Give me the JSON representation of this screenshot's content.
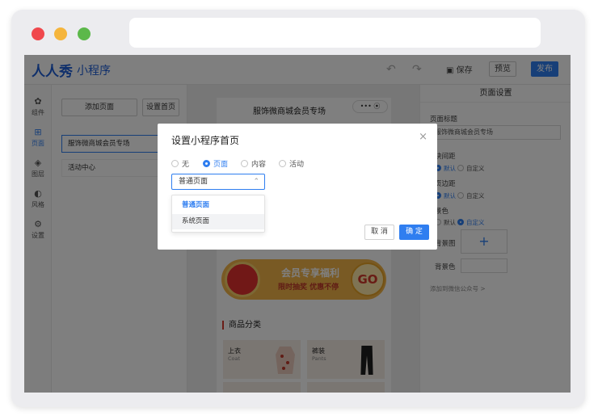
{
  "colors": {
    "accent": "#2f7ef0",
    "brand": "#1f5fd6",
    "banner": "#f3b449",
    "danger": "#d63a2f"
  },
  "topbar": {
    "logo": "人人秀",
    "logo_sub": "小程序",
    "undo_icon": "undo-icon",
    "redo_icon": "redo-icon",
    "save_label": "保存",
    "preview_label": "预览",
    "publish_label": "发布"
  },
  "leftnav": {
    "items": [
      {
        "label": "组件",
        "icon": "puzzle-icon"
      },
      {
        "label": "页面",
        "icon": "page-icon"
      },
      {
        "label": "图层",
        "icon": "layers-icon"
      },
      {
        "label": "风格",
        "icon": "palette-icon"
      },
      {
        "label": "设置",
        "icon": "gear-icon"
      }
    ]
  },
  "pagepanel": {
    "add_page": "添加页面",
    "set_home": "设置首页",
    "pages": [
      "服饰微商城会员专场",
      "活动中心"
    ]
  },
  "phone": {
    "title": "服饰微商城会员专场",
    "capsule": "••• ⦿",
    "banner_title": "会员专享福利",
    "banner_sub": "限时抽奖 优惠不停",
    "banner_go": "GO",
    "category_title": "商品分类",
    "categories": [
      {
        "name": "上衣",
        "en": "Coat"
      },
      {
        "name": "裤装",
        "en": "Pants"
      }
    ]
  },
  "rightpanel": {
    "header": "页面设置",
    "page_title_label": "页面标题",
    "page_title_value": "服饰微商城会员专场",
    "spacing_label": "块间距",
    "margin_label": "页边距",
    "bg_color_label": "景色",
    "default_label": "默认",
    "custom_label": "自定义",
    "bg_image_label": "背景图",
    "bg_color2_label": "背景色",
    "add_link": "添加到微信公众号 >"
  },
  "modal": {
    "title": "设置小程序首页",
    "close": "×",
    "radios": [
      "无",
      "页面",
      "内容",
      "活动"
    ],
    "selected_radio": "页面",
    "select_value": "普通页面",
    "options": [
      "普通页面",
      "系统页面"
    ],
    "cancel_label": "取 消",
    "ok_label": "确 定"
  }
}
